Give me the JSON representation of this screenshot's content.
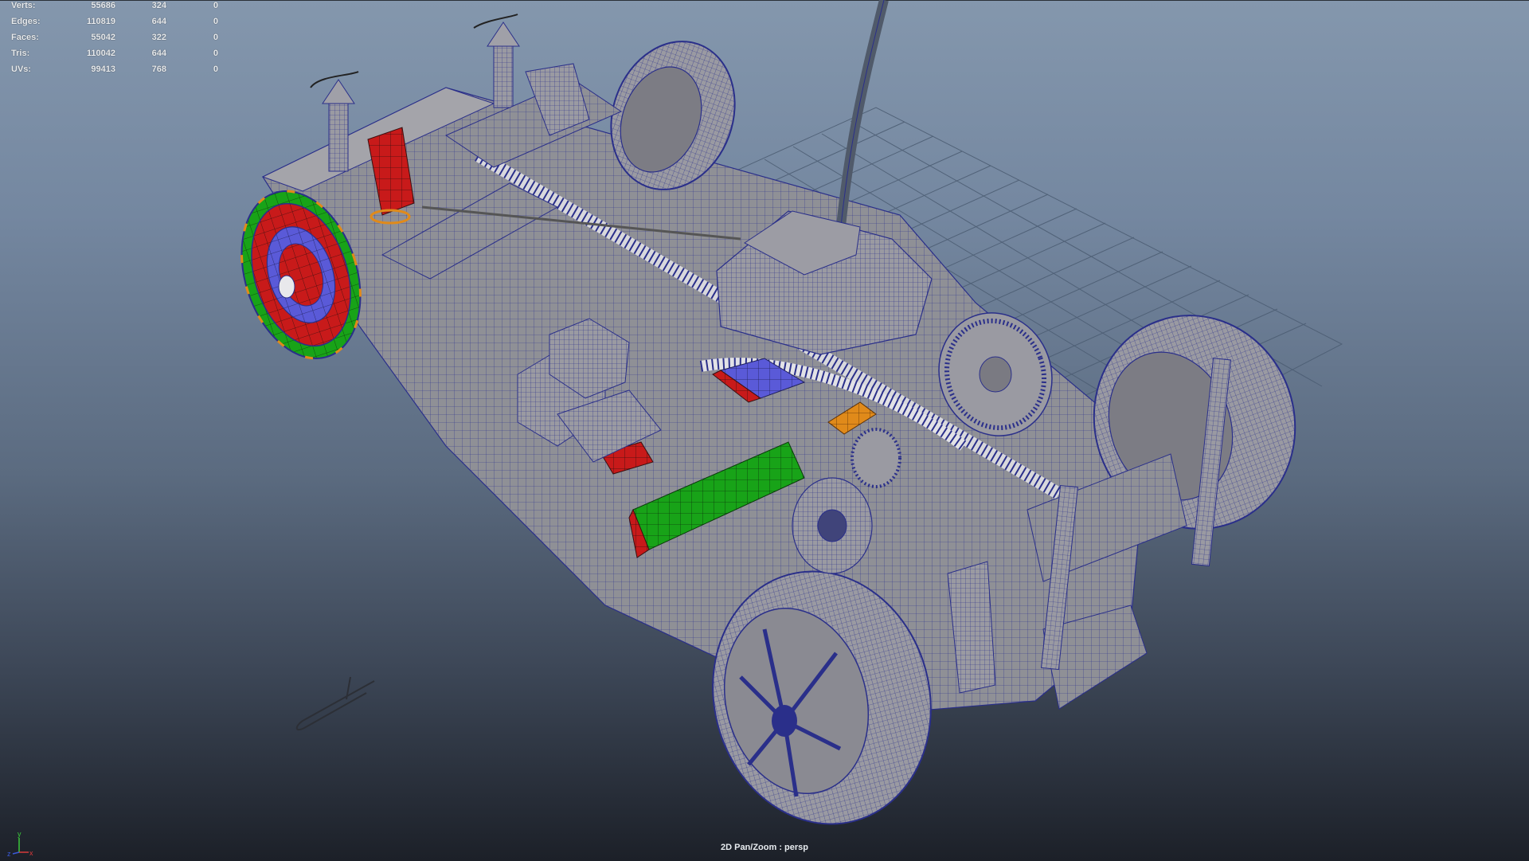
{
  "hud": {
    "rows": [
      {
        "label": "Verts:",
        "v1": "55686",
        "v2": "324",
        "v3": "0"
      },
      {
        "label": "Edges:",
        "v1": "110819",
        "v2": "644",
        "v3": "0"
      },
      {
        "label": "Faces:",
        "v1": "55042",
        "v2": "322",
        "v3": "0"
      },
      {
        "label": "Tris:",
        "v1": "110042",
        "v2": "644",
        "v3": "0"
      },
      {
        "label": "UVs:",
        "v1": "99413",
        "v2": "768",
        "v3": "0"
      }
    ]
  },
  "camera": {
    "label": "2D Pan/Zoom : persp"
  },
  "axis": {
    "y": "y",
    "x": "x",
    "z": "z"
  },
  "colors": {
    "wireframe": "#2a2f8a",
    "mesh_fill": "#8e8e94",
    "selected_red": "#d01818",
    "selected_green": "#17a317",
    "selected_blue": "#5a5ad8",
    "selected_orange": "#e08a1a",
    "grid": "#4a5a6e"
  },
  "icons": {
    "axis_gizmo": "axis-gizmo-icon"
  }
}
